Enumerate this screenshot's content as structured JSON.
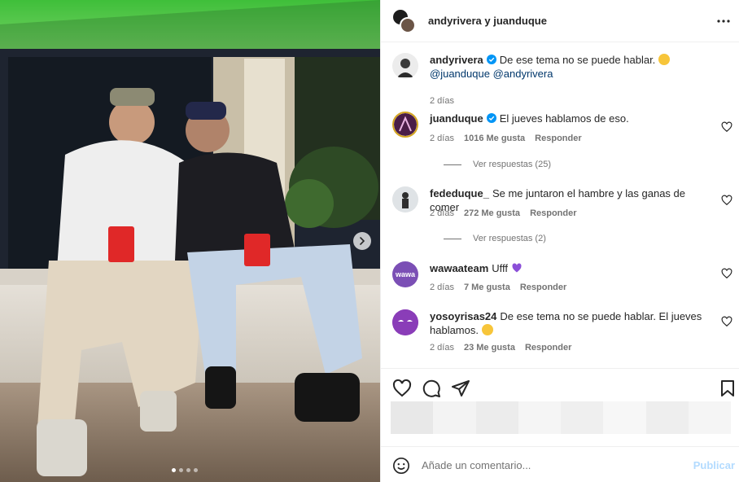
{
  "post": {
    "header_title": "andyrivera y juanduque",
    "more_icon": "more-horizontal-icon",
    "carousel_dots": 4,
    "carousel_active": 1
  },
  "caption": {
    "username": "andyrivera",
    "text": "De ese tema no se puede hablar.",
    "mention1": "@juanduque",
    "mention2": "@andyrivera",
    "time": "2 días"
  },
  "comments": [
    {
      "username": "juanduque",
      "verified": true,
      "text": "El jueves hablamos de eso.",
      "time": "2 días",
      "likes": "1016 Me gusta",
      "reply": "Responder",
      "view_replies": "Ver respuestas (25)"
    },
    {
      "username": "fededuque_",
      "verified": false,
      "text": "Se me juntaron el hambre y las ganas de comer",
      "time": "2 días",
      "likes": "272 Me gusta",
      "reply": "Responder",
      "view_replies": "Ver respuestas (2)"
    },
    {
      "username": "wawaateam",
      "verified": false,
      "text": "Ufff",
      "time": "2 días",
      "likes": "7 Me gusta",
      "reply": "Responder"
    },
    {
      "username": "yosoyrisas24",
      "verified": false,
      "text_line1": "De ese tema no se puede hablar. El jueves",
      "text_line2": "hablamos.",
      "time": "2 días",
      "likes": "23 Me gusta",
      "reply": "Responder"
    }
  ],
  "wawa_badge": "wawa",
  "composer": {
    "placeholder": "Añade un comentario...",
    "publish": "Publicar"
  },
  "colors": {
    "link": "#00376b",
    "muted": "#737373",
    "verified": "#0095f6",
    "publish": "#b3dbff",
    "wawa_purple": "#7b4fb5"
  }
}
